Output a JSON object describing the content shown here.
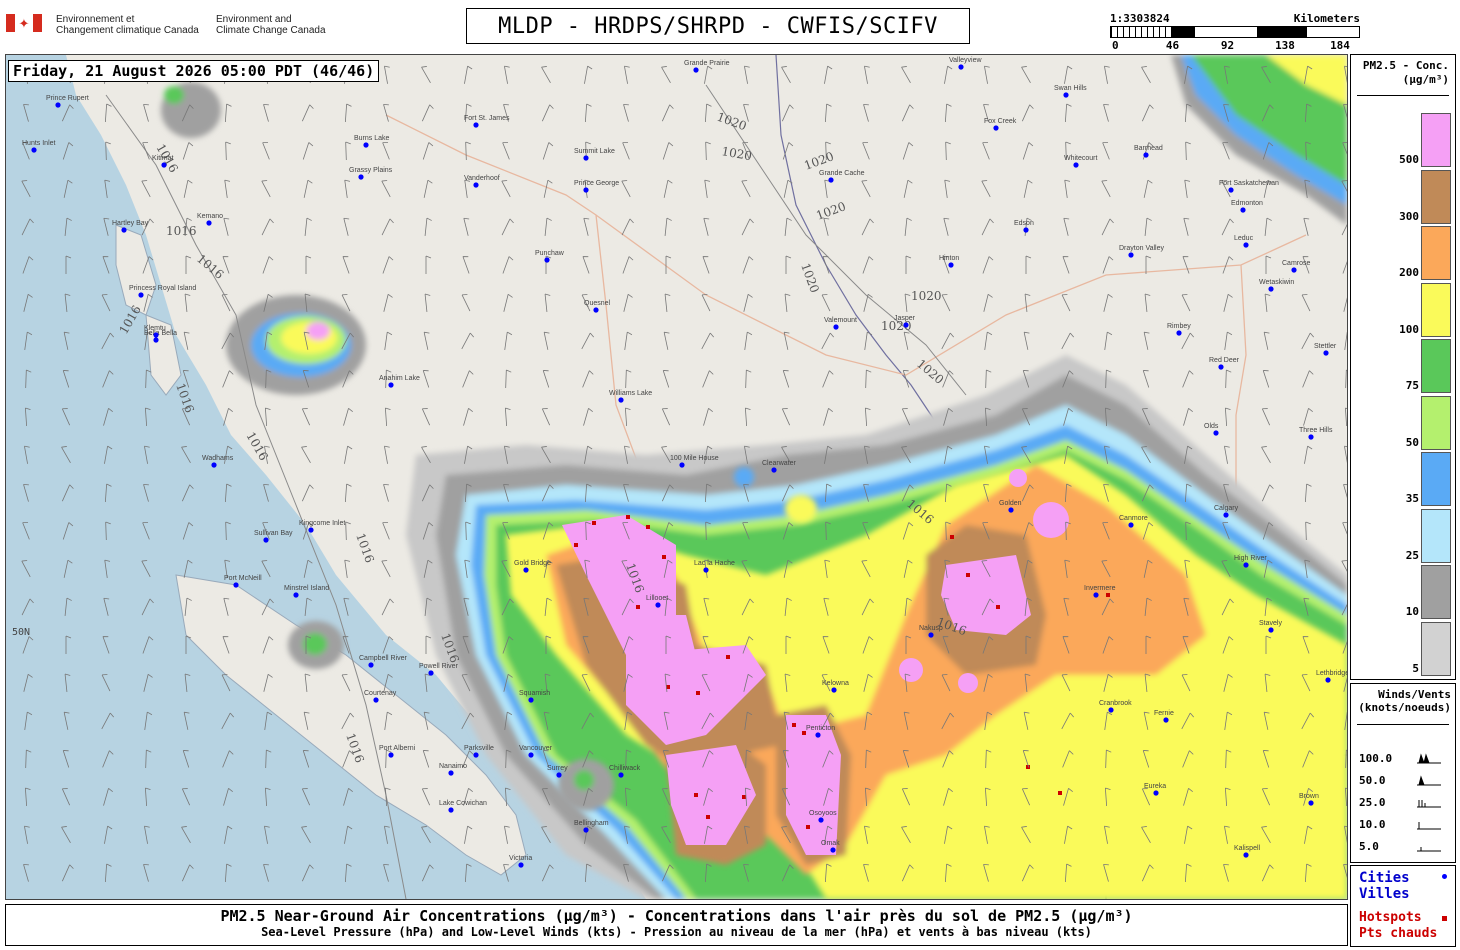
{
  "header": {
    "gov_fr": "Environnement et\nChangement climatique Canada",
    "gov_en": "Environment and\nClimate Change Canada",
    "title": "MLDP - HRDPS/SHRPD - CWFIS/SCIFV",
    "scale_ratio": "1:3303824",
    "scale_unit": "Kilometers",
    "scale_ticks": [
      "0",
      "46",
      "92",
      "138",
      "184"
    ]
  },
  "map": {
    "timestamp": "Friday, 21 August 2026 05:00 PDT (46/46)",
    "lat_label": "50N",
    "isobar_labels": [
      "1016",
      "1020"
    ],
    "colors": {
      "land": "#eceae4",
      "water": "#b7d3e2",
      "city_dot": "#0000ff",
      "hotspot": "#cc0000"
    },
    "cities": [
      {
        "name": "Prince Rupert"
      },
      {
        "name": "Hunts Inlet"
      },
      {
        "name": "Kitimat"
      },
      {
        "name": "Hartley Bay"
      },
      {
        "name": "Kemano"
      },
      {
        "name": "Fort St. James"
      },
      {
        "name": "Burns Lake"
      },
      {
        "name": "Grassy Plains"
      },
      {
        "name": "Vanderhoof"
      },
      {
        "name": "Summit Lake"
      },
      {
        "name": "Prince George"
      },
      {
        "name": "Punchaw"
      },
      {
        "name": "Quesnel"
      },
      {
        "name": "Williams Lake"
      },
      {
        "name": "Bella Bella"
      },
      {
        "name": "Anahim Lake"
      },
      {
        "name": "Wadhams"
      },
      {
        "name": "Klemtu"
      },
      {
        "name": "Princess Royal Island"
      },
      {
        "name": "100 Mile House"
      },
      {
        "name": "Clearwater"
      },
      {
        "name": "Kingcome Inlet"
      },
      {
        "name": "Sullivan Bay"
      },
      {
        "name": "Port McNeill"
      },
      {
        "name": "Minstrel Island"
      },
      {
        "name": "Campbell River"
      },
      {
        "name": "Powell River"
      },
      {
        "name": "Courtenay"
      },
      {
        "name": "Squamish"
      },
      {
        "name": "Port Alberni"
      },
      {
        "name": "Parksville"
      },
      {
        "name": "Nanaimo"
      },
      {
        "name": "Vancouver"
      },
      {
        "name": "Surrey"
      },
      {
        "name": "Chilliwack"
      },
      {
        "name": "Bellingham"
      },
      {
        "name": "Lake Cowichan"
      },
      {
        "name": "Victoria"
      },
      {
        "name": "Gold Bridge"
      },
      {
        "name": "Lillooet"
      },
      {
        "name": "Lac la Hache"
      },
      {
        "name": "Kelowna"
      },
      {
        "name": "Penticton"
      },
      {
        "name": "Osoyoos"
      },
      {
        "name": "Omak"
      },
      {
        "name": "Valemount"
      },
      {
        "name": "Jasper"
      },
      {
        "name": "Hinton"
      },
      {
        "name": "Edson"
      },
      {
        "name": "Whitecourt"
      },
      {
        "name": "Fox Creek"
      },
      {
        "name": "Swan Hills"
      },
      {
        "name": "Barrhead"
      },
      {
        "name": "Fort Saskatchewan"
      },
      {
        "name": "Edmonton"
      },
      {
        "name": "Leduc"
      },
      {
        "name": "Drayton Valley"
      },
      {
        "name": "Camrose"
      },
      {
        "name": "Wetaskiwin"
      },
      {
        "name": "Rimbey"
      },
      {
        "name": "Stettler"
      },
      {
        "name": "Red Deer"
      },
      {
        "name": "Olds"
      },
      {
        "name": "Three Hills"
      },
      {
        "name": "Calgary"
      },
      {
        "name": "Canmore"
      },
      {
        "name": "Golden"
      },
      {
        "name": "High River"
      },
      {
        "name": "Invermere"
      },
      {
        "name": "Nakusp"
      },
      {
        "name": "Cranbrook"
      },
      {
        "name": "Fernie"
      },
      {
        "name": "Lethbridge"
      },
      {
        "name": "Eureka"
      },
      {
        "name": "Kalispell"
      },
      {
        "name": "Grande Cache"
      },
      {
        "name": "Grande Prairie"
      },
      {
        "name": "Valleyview"
      },
      {
        "name": "Stavely"
      },
      {
        "name": "Brown"
      }
    ]
  },
  "legend": {
    "title_line1": "PM2.5 - Conc.",
    "title_line2": "(μg/m³)",
    "levels": [
      {
        "label": "500",
        "color": "#f5a0f5"
      },
      {
        "label": "300",
        "color": "#c08a58"
      },
      {
        "label": "200",
        "color": "#fba85a"
      },
      {
        "label": "100",
        "color": "#fafa5a"
      },
      {
        "label": "75",
        "color": "#5ac85a"
      },
      {
        "label": "50",
        "color": "#b4f06e"
      },
      {
        "label": "35",
        "color": "#5aaaf5"
      },
      {
        "label": "25",
        "color": "#b4e6fa"
      },
      {
        "label": "10",
        "color": "#a0a0a0"
      },
      {
        "label": "5",
        "color": "#d2d2d2"
      }
    ]
  },
  "winds": {
    "title_line1": "Winds/Vents",
    "title_line2": "(knots/noeuds)",
    "rows": [
      {
        "label": "100.0",
        "glyph": "pennant-icon"
      },
      {
        "label": "50.0",
        "glyph": "pennant-icon"
      },
      {
        "label": "25.0",
        "glyph": "barb-icon"
      },
      {
        "label": "10.0",
        "glyph": "barb-icon"
      },
      {
        "label": "5.0",
        "glyph": "half-barb-icon"
      }
    ]
  },
  "key": {
    "cities_en": "Cities",
    "cities_fr": "Villes",
    "hotspots_en": "Hotspots",
    "hotspots_fr": "Pts chauds",
    "city_color": "#0000ff",
    "hotspot_color": "#cc0000"
  },
  "footer": {
    "line1": "PM2.5 Near-Ground Air Concentrations (μg/m³) - Concentrations dans l'air près du sol de PM2.5 (μg/m³)",
    "line2": "Sea-Level Pressure (hPa) and Low-Level Winds (kts) - Pression au niveau de la mer (hPa) et vents à bas niveau (kts)"
  }
}
